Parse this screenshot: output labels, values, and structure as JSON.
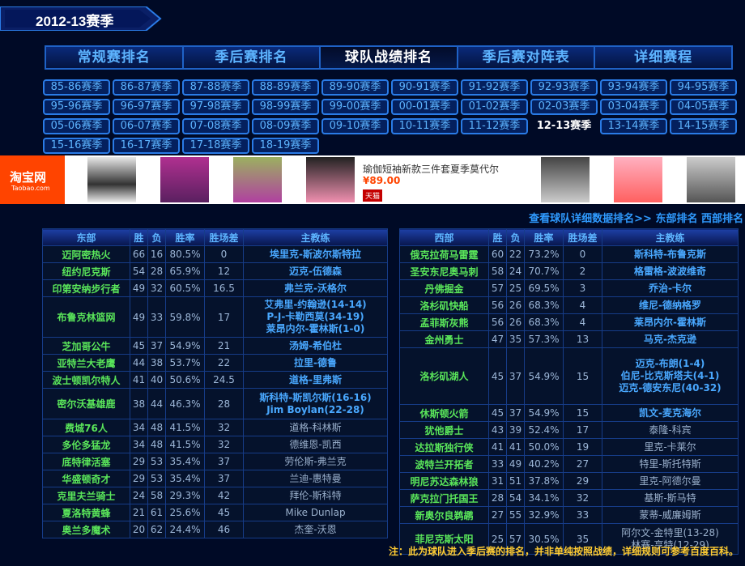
{
  "season_title": "2012-13赛季",
  "main_tabs": [
    {
      "label": "常规赛排名",
      "active": false
    },
    {
      "label": "季后赛排名",
      "active": false
    },
    {
      "label": "球队战绩排名",
      "active": true
    },
    {
      "label": "季后赛对阵表",
      "active": false
    },
    {
      "label": "详细赛程",
      "active": false
    }
  ],
  "seasons": [
    "85-86赛季",
    "86-87赛季",
    "87-88赛季",
    "88-89赛季",
    "89-90赛季",
    "90-91赛季",
    "91-92赛季",
    "92-93赛季",
    "93-94赛季",
    "94-95赛季",
    "95-96赛季",
    "96-97赛季",
    "97-98赛季",
    "98-99赛季",
    "99-00赛季",
    "00-01赛季",
    "01-02赛季",
    "02-03赛季",
    "03-04赛季",
    "04-05赛季",
    "05-06赛季",
    "06-07赛季",
    "07-08赛季",
    "08-09赛季",
    "09-10赛季",
    "10-11赛季",
    "11-12赛季",
    "12-13赛季",
    "13-14赛季",
    "14-15赛季",
    "15-16赛季",
    "16-17赛季",
    "17-18赛季",
    "18-19赛季"
  ],
  "active_season": "12-13赛季",
  "ad": {
    "logo": "淘宝网",
    "logo_sub": "Taobao.com",
    "text": "瑜伽短袖新款三件套夏季莫代尔",
    "price": "¥89.00",
    "badge": "天猫"
  },
  "links": {
    "detail": "查看球队详细数据排名>>",
    "east": "东部排名",
    "west": "西部排名"
  },
  "columns": {
    "win": "胜",
    "loss": "负",
    "pct": "胜率",
    "gb": "胜场差",
    "coach": "主教练"
  },
  "east": {
    "header": "东部",
    "rows": [
      {
        "team": "迈阿密热火",
        "w": "66",
        "l": "16",
        "pct": "80.5%",
        "gb": "0",
        "coach": [
          "埃里克-斯波尔斯特拉"
        ],
        "cls": ""
      },
      {
        "team": "纽约尼克斯",
        "w": "54",
        "l": "28",
        "pct": "65.9%",
        "gb": "12",
        "coach": [
          "迈克-伍德森"
        ],
        "cls": ""
      },
      {
        "team": "印第安纳步行者",
        "w": "49",
        "l": "32",
        "pct": "60.5%",
        "gb": "16.5",
        "coach": [
          "弗兰克-沃格尔"
        ],
        "cls": ""
      },
      {
        "team": "布鲁克林篮网",
        "w": "49",
        "l": "33",
        "pct": "59.8%",
        "gb": "17",
        "coach": [
          "艾弗里-约翰逊(14-14)",
          "P-J-卡勒西莫(34-19)",
          "莱昂内尔-霍林斯(1-0)"
        ],
        "cls": "tall3"
      },
      {
        "team": "芝加哥公牛",
        "w": "45",
        "l": "37",
        "pct": "54.9%",
        "gb": "21",
        "coach": [
          "汤姆-希伯杜"
        ],
        "cls": ""
      },
      {
        "team": "亚特兰大老鹰",
        "w": "44",
        "l": "38",
        "pct": "53.7%",
        "gb": "22",
        "coach": [
          "拉里-德鲁"
        ],
        "cls": ""
      },
      {
        "team": "波士顿凯尔特人",
        "w": "41",
        "l": "40",
        "pct": "50.6%",
        "gb": "24.5",
        "coach": [
          "道格-里弗斯"
        ],
        "cls": ""
      },
      {
        "team": "密尔沃基雄鹿",
        "w": "38",
        "l": "44",
        "pct": "46.3%",
        "gb": "28",
        "coach": [
          "斯科特-斯凯尔斯(16-16)",
          "Jim Boylan(22-28)"
        ],
        "cls": "tall2"
      },
      {
        "team": "费城76人",
        "w": "34",
        "l": "48",
        "pct": "41.5%",
        "gb": "32",
        "coach": [
          "道格-科林斯"
        ],
        "cls": "gray"
      },
      {
        "team": "多伦多猛龙",
        "w": "34",
        "l": "48",
        "pct": "41.5%",
        "gb": "32",
        "coach": [
          "德维恩-凯西"
        ],
        "cls": "gray"
      },
      {
        "team": "底特律活塞",
        "w": "29",
        "l": "53",
        "pct": "35.4%",
        "gb": "37",
        "coach": [
          "劳伦斯-弗兰克"
        ],
        "cls": "gray"
      },
      {
        "team": "华盛顿奇才",
        "w": "29",
        "l": "53",
        "pct": "35.4%",
        "gb": "37",
        "coach": [
          "兰迪-惠特曼"
        ],
        "cls": "gray"
      },
      {
        "team": "克里夫兰骑士",
        "w": "24",
        "l": "58",
        "pct": "29.3%",
        "gb": "42",
        "coach": [
          "拜伦-斯科特"
        ],
        "cls": "gray"
      },
      {
        "team": "夏洛特黄蜂",
        "w": "21",
        "l": "61",
        "pct": "25.6%",
        "gb": "45",
        "coach": [
          "Mike Dunlap"
        ],
        "cls": "gray"
      },
      {
        "team": "奥兰多魔术",
        "w": "20",
        "l": "62",
        "pct": "24.4%",
        "gb": "46",
        "coach": [
          "杰奎-沃恩"
        ],
        "cls": "gray"
      }
    ]
  },
  "west": {
    "header": "西部",
    "rows": [
      {
        "team": "俄克拉荷马雷霆",
        "w": "60",
        "l": "22",
        "pct": "73.2%",
        "gb": "0",
        "coach": [
          "斯科特-布鲁克斯"
        ],
        "cls": ""
      },
      {
        "team": "圣安东尼奥马刺",
        "w": "58",
        "l": "24",
        "pct": "70.7%",
        "gb": "2",
        "coach": [
          "格雷格-波波维奇"
        ],
        "cls": ""
      },
      {
        "team": "丹佛掘金",
        "w": "57",
        "l": "25",
        "pct": "69.5%",
        "gb": "3",
        "coach": [
          "乔治-卡尔"
        ],
        "cls": ""
      },
      {
        "team": "洛杉矶快船",
        "w": "56",
        "l": "26",
        "pct": "68.3%",
        "gb": "4",
        "coach": [
          "维尼-德纳格罗"
        ],
        "cls": ""
      },
      {
        "team": "孟菲斯灰熊",
        "w": "56",
        "l": "26",
        "pct": "68.3%",
        "gb": "4",
        "coach": [
          "莱昂内尔-霍林斯"
        ],
        "cls": ""
      },
      {
        "team": "金州勇士",
        "w": "47",
        "l": "35",
        "pct": "57.3%",
        "gb": "13",
        "coach": [
          "马克-杰克逊"
        ],
        "cls": ""
      },
      {
        "team": "洛杉矶湖人",
        "w": "45",
        "l": "37",
        "pct": "54.9%",
        "gb": "15",
        "coach": [
          "迈克-布朗(1-4)",
          "伯尼-比克斯塔夫(4-1)",
          "迈克-德安东尼(40-32)"
        ],
        "cls": "talllakers"
      },
      {
        "team": "休斯顿火箭",
        "w": "45",
        "l": "37",
        "pct": "54.9%",
        "gb": "15",
        "coach": [
          "凯文-麦克海尔"
        ],
        "cls": ""
      },
      {
        "team": "犹他爵士",
        "w": "43",
        "l": "39",
        "pct": "52.4%",
        "gb": "17",
        "coach": [
          "泰隆-科宾"
        ],
        "cls": "gray"
      },
      {
        "team": "达拉斯独行侠",
        "w": "41",
        "l": "41",
        "pct": "50.0%",
        "gb": "19",
        "coach": [
          "里克-卡莱尔"
        ],
        "cls": "gray"
      },
      {
        "team": "波特兰开拓者",
        "w": "33",
        "l": "49",
        "pct": "40.2%",
        "gb": "27",
        "coach": [
          "特里-斯托特斯"
        ],
        "cls": "gray"
      },
      {
        "team": "明尼苏达森林狼",
        "w": "31",
        "l": "51",
        "pct": "37.8%",
        "gb": "29",
        "coach": [
          "里克-阿德尔曼"
        ],
        "cls": "gray"
      },
      {
        "team": "萨克拉门托国王",
        "w": "28",
        "l": "54",
        "pct": "34.1%",
        "gb": "32",
        "coach": [
          "基斯-斯马特"
        ],
        "cls": "gray"
      },
      {
        "team": "新奥尔良鹈鹕",
        "w": "27",
        "l": "55",
        "pct": "32.9%",
        "gb": "33",
        "coach": [
          "蒙蒂-威廉姆斯"
        ],
        "cls": "gray"
      },
      {
        "team": "菲尼克斯太阳",
        "w": "25",
        "l": "57",
        "pct": "30.5%",
        "gb": "35",
        "coach": [
          "阿尔文-金特里(13-28)",
          "林赛-亨特(12-29)"
        ],
        "cls": "tall2 gray"
      }
    ]
  },
  "note": "注：此为球队进入季后赛的排名，并非单纯按照战绩，详细规则可参考百度百科。",
  "colors": {
    "background": "#000a26",
    "team_green": "#5ae65a",
    "link_blue": "#2f9bff",
    "note_yellow": "#ffcc33"
  }
}
